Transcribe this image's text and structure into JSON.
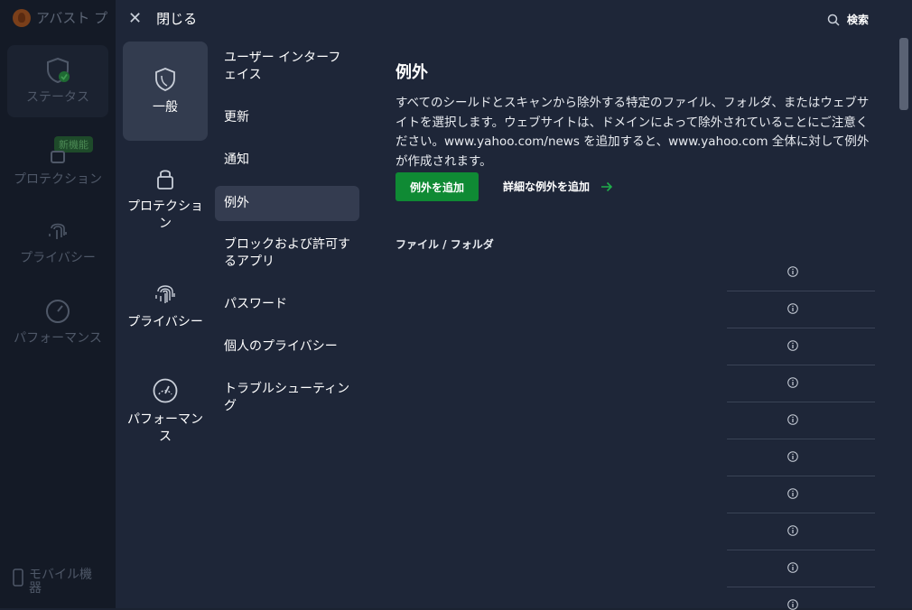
{
  "background_app": {
    "title": "アバスト プ",
    "nav": {
      "status": "ステータス",
      "protection": "プロテクション",
      "new_badge": "新機能",
      "privacy": "プライバシー",
      "performance": "パフォーマンス"
    },
    "mobile": "モバイル機器"
  },
  "topbar": {
    "close_label": "閉じる",
    "search_label": "検索"
  },
  "categories": {
    "general": "一般",
    "protection": "プロテクション",
    "privacy": "プライバシー",
    "performance": "パフォーマンス"
  },
  "submenu": {
    "ui": "ユーザー インターフェイス",
    "update": "更新",
    "notifications": "通知",
    "exceptions": "例外",
    "blocked_apps": "ブロックおよび許可するアプリ",
    "passwords": "パスワード",
    "personal_privacy": "個人のプライバシー",
    "troubleshooting": "トラブルシューティング"
  },
  "content": {
    "title": "例外",
    "description": "すべてのシールドとスキャンから除外する特定のファイル、フォルダ、またはウェブサイトを選択します。ウェブサイトは、ドメインによって除外されていることにご注意ください。www.yahoo.com/news を追加すると、www.yahoo.com 全体に対して例外が作成されます。",
    "add_button": "例外を追加",
    "advanced_link": "詳細な例外を追加",
    "section_label": "ファイル / フォルダ"
  },
  "colors": {
    "accent_green": "#0f8a34",
    "overlay_bg": "#1e2638",
    "active_item": "#333c4f"
  }
}
